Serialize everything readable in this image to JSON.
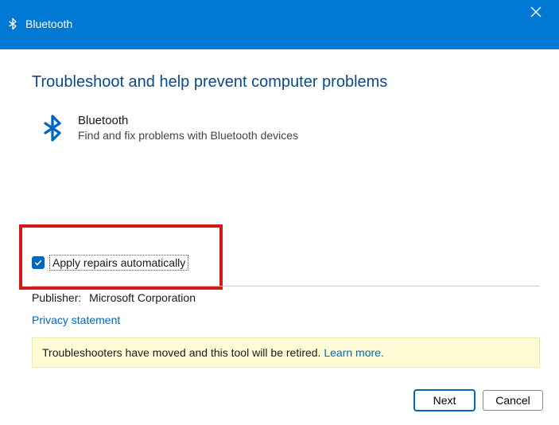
{
  "titlebar": {
    "title": "Bluetooth"
  },
  "heading": "Troubleshoot and help prevent computer problems",
  "troubleshooter": {
    "name": "Bluetooth",
    "description": "Find and fix problems with Bluetooth devices"
  },
  "repair_checkbox": {
    "label": "Apply repairs automatically",
    "checked": true
  },
  "publisher": {
    "label": "Publisher:",
    "value": "Microsoft Corporation"
  },
  "privacy_link": "Privacy statement",
  "notice": {
    "text": "Troubleshooters have moved and this tool will be retired. ",
    "learn_more": "Learn more."
  },
  "footer": {
    "next": "Next",
    "cancel": "Cancel"
  }
}
